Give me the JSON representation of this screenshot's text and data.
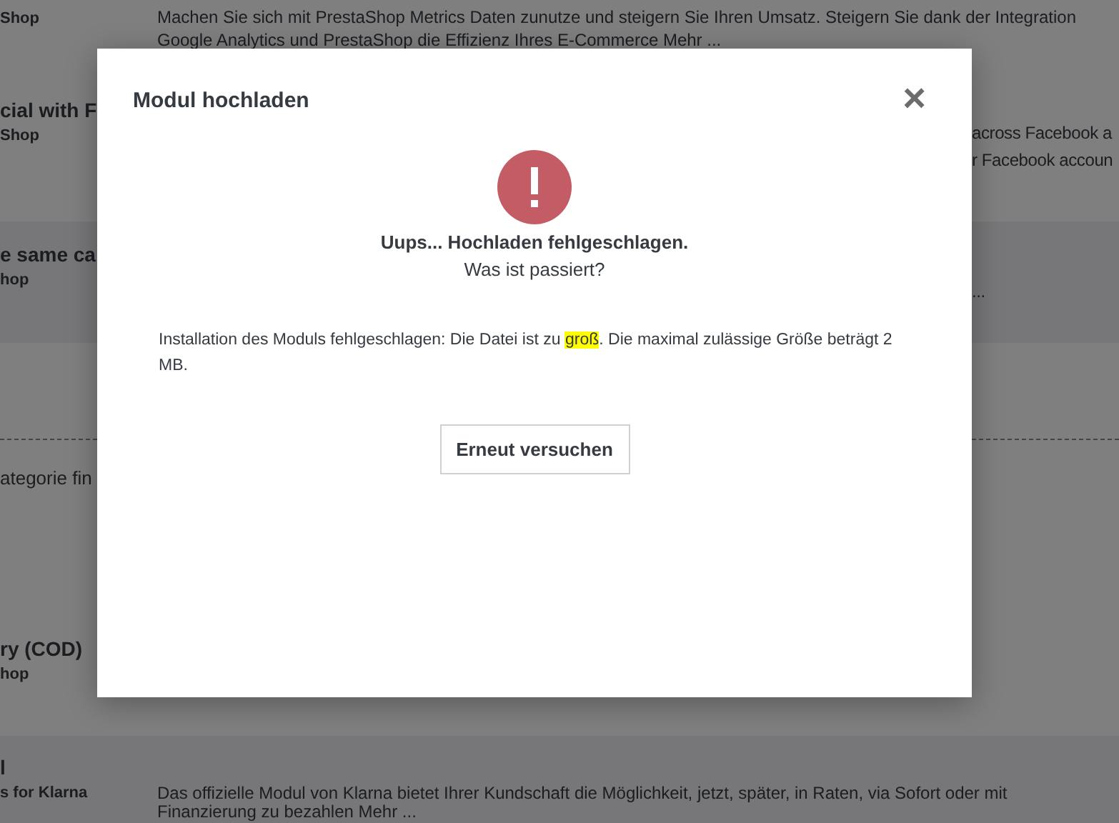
{
  "background_modules": [
    {
      "author": "Shop",
      "description": [
        "Machen Sie sich mit PrestaShop Metrics Daten zunutze und steigern Sie Ihren Umsatz. Steigern Sie dank der Integration",
        "Google Analytics und PrestaShop die Effizienz Ihres E-Commerce Mehr ..."
      ]
    },
    {
      "title": "cial with F",
      "author": "Shop",
      "description_tail": [
        "across Facebook a",
        "r Facebook accoun"
      ]
    },
    {
      "title": "e same ca",
      "author": "hop",
      "description_tail": [
        "..."
      ]
    },
    {
      "category_hint": "ategorie fin"
    },
    {
      "title": "ry (COD)",
      "author": "hop"
    },
    {
      "title": "l",
      "author": "s for Klarna",
      "description": [
        "Das offizielle Modul von Klarna bietet Ihrer Kundschaft die Möglichkeit, jetzt, später, in Raten, via Sofort oder mit",
        "Finanzierung zu bezahlen Mehr ..."
      ]
    }
  ],
  "modal": {
    "title": "Modul hochladen",
    "close": "×",
    "heading": "Uups... Hochladen fehlgeschlagen.",
    "subheading": "Was ist passiert?",
    "message": {
      "before": "Installation des Moduls fehlgeschlagen: Die Datei ist zu ",
      "highlighted": "groß",
      "after": ". Die maximal zulässige Größe beträgt 2 MB."
    },
    "button": "Erneut versuchen"
  }
}
